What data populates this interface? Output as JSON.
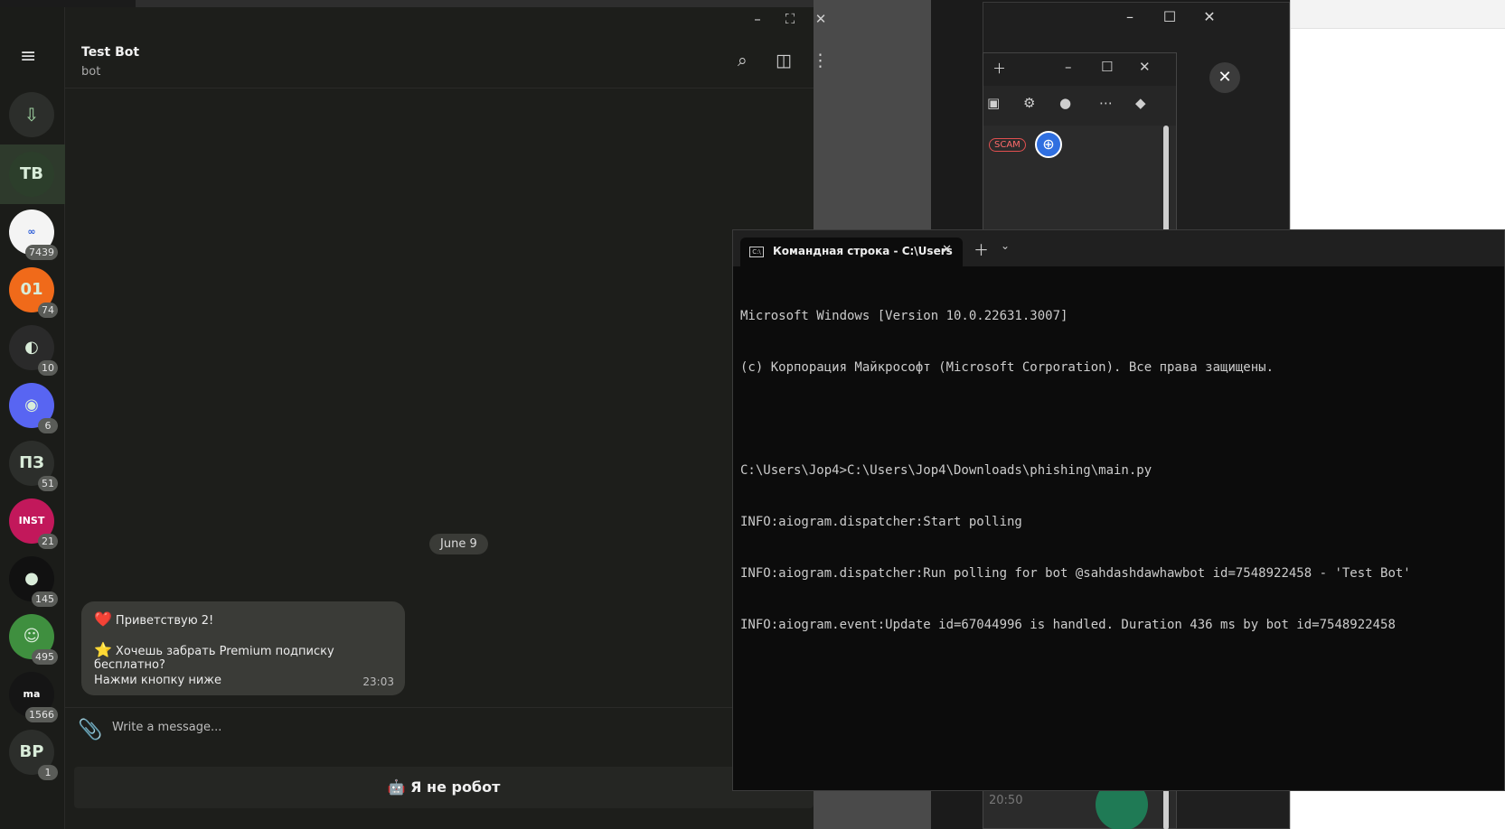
{
  "telegram": {
    "chat_title": "Test Bot",
    "chat_subtitle": "bot",
    "date_separator": "June 9",
    "message": {
      "line1": "Приветствую 2!",
      "line2": "Хочешь забрать Premium подписку бесплатно?",
      "line3": "Нажми кнопку ниже",
      "time": "23:03",
      "emoji1": "❤️",
      "emoji2": "⭐"
    },
    "composer_placeholder": "Write a message...",
    "keyboard_button": "🤖 Я не робот",
    "chats": [
      {
        "label": "TB",
        "badge": "",
        "color": "#2c3e2b"
      },
      {
        "label": "∞",
        "badge": "7439",
        "color": "#f4f4f4"
      },
      {
        "label": "01",
        "badge": "74",
        "color": "#f06a1a"
      },
      {
        "label": "◐",
        "badge": "10",
        "color": "#2a2a2a"
      },
      {
        "label": "◉",
        "badge": "6",
        "color": "#5865f2"
      },
      {
        "label": "ПЗ",
        "badge": "51",
        "color": "#2c2e2b"
      },
      {
        "label": "INST",
        "badge": "21",
        "color": "#c2185b"
      },
      {
        "label": "●",
        "badge": "145",
        "color": "#111111"
      },
      {
        "label": "☺",
        "badge": "495",
        "color": "#3f8f3f"
      },
      {
        "label": "ma",
        "badge": "1566",
        "color": "#151515"
      },
      {
        "label": "BP",
        "badge": "1",
        "color": "#2c2e2b"
      }
    ]
  },
  "cmd": {
    "tab_title": "Командная строка - C:\\Users",
    "lines": [
      "Microsoft Windows [Version 10.0.22631.3007]",
      "(c) Корпорация Майкрософт (Microsoft Corporation). Все права защищены.",
      "",
      "C:\\Users\\Jop4>C:\\Users\\Jop4\\Downloads\\phishing\\main.py",
      "INFO:aiogram.dispatcher:Start polling",
      "INFO:aiogram.dispatcher:Run polling for bot @sahdashdawhawbot id=7548922458 - 'Test Bot'",
      "INFO:aiogram.event:Update id=67044996 is handled. Duration 436 ms by bot id=7548922458"
    ]
  },
  "browser": {
    "scam_label": "SCAM",
    "faded_time": "20:50"
  }
}
